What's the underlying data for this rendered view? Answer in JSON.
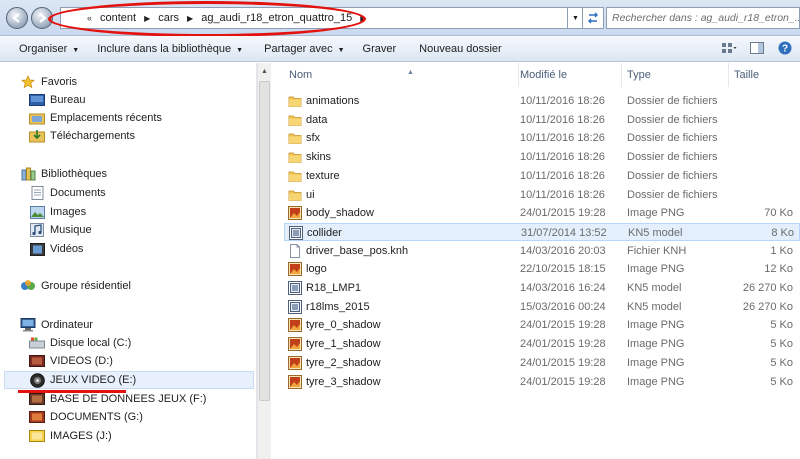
{
  "address": {
    "separator": "«",
    "crumbs": [
      "content",
      "cars",
      "ag_audi_r18_etron_quattro_15"
    ],
    "search_placeholder": "Rechercher dans : ag_audi_r18_etron_..."
  },
  "toolbar": {
    "organize": "Organiser",
    "include_library": "Inclure dans la bibliothèque",
    "share_with": "Partager avec",
    "burn": "Graver",
    "new_folder": "Nouveau dossier"
  },
  "nav": {
    "favorites": "Favoris",
    "favorites_items": [
      "Bureau",
      "Emplacements récents",
      "Téléchargements"
    ],
    "libraries": "Bibliothèques",
    "libraries_items": [
      "Documents",
      "Images",
      "Musique",
      "Vidéos"
    ],
    "homegroup": "Groupe résidentiel",
    "computer": "Ordinateur",
    "drives": [
      "Disque local (C:)",
      "VIDEOS (D:)",
      "JEUX VIDEO (E:)",
      "BASE DE DONNEES JEUX (F:)",
      "DOCUMENTS (G:)",
      "IMAGES (J:)"
    ]
  },
  "columns": {
    "name": "Nom",
    "modified": "Modifié le",
    "type": "Type",
    "size": "Taille"
  },
  "files": [
    {
      "name": "animations",
      "date": "10/11/2016 18:26",
      "type": "Dossier de fichiers",
      "size": "",
      "icon": "folder"
    },
    {
      "name": "data",
      "date": "10/11/2016 18:26",
      "type": "Dossier de fichiers",
      "size": "",
      "icon": "folder"
    },
    {
      "name": "sfx",
      "date": "10/11/2016 18:26",
      "type": "Dossier de fichiers",
      "size": "",
      "icon": "folder"
    },
    {
      "name": "skins",
      "date": "10/11/2016 18:26",
      "type": "Dossier de fichiers",
      "size": "",
      "icon": "folder"
    },
    {
      "name": "texture",
      "date": "10/11/2016 18:26",
      "type": "Dossier de fichiers",
      "size": "",
      "icon": "folder"
    },
    {
      "name": "ui",
      "date": "10/11/2016 18:26",
      "type": "Dossier de fichiers",
      "size": "",
      "icon": "folder"
    },
    {
      "name": "body_shadow",
      "date": "24/01/2015 19:28",
      "type": "Image PNG",
      "size": "70 Ko",
      "icon": "png"
    },
    {
      "name": "collider",
      "date": "31/07/2014 13:52",
      "type": "KN5 model",
      "size": "8 Ko",
      "icon": "kn5"
    },
    {
      "name": "driver_base_pos.knh",
      "date": "14/03/2016 20:03",
      "type": "Fichier KNH",
      "size": "1 Ko",
      "icon": "blank"
    },
    {
      "name": "logo",
      "date": "22/10/2015 18:15",
      "type": "Image PNG",
      "size": "12 Ko",
      "icon": "png"
    },
    {
      "name": "R18_LMP1",
      "date": "14/03/2016 16:24",
      "type": "KN5 model",
      "size": "26 270 Ko",
      "icon": "kn5"
    },
    {
      "name": "r18lms_2015",
      "date": "15/03/2016 00:24",
      "type": "KN5 model",
      "size": "26 270 Ko",
      "icon": "kn5"
    },
    {
      "name": "tyre_0_shadow",
      "date": "24/01/2015 19:28",
      "type": "Image PNG",
      "size": "5 Ko",
      "icon": "png"
    },
    {
      "name": "tyre_1_shadow",
      "date": "24/01/2015 19:28",
      "type": "Image PNG",
      "size": "5 Ko",
      "icon": "png"
    },
    {
      "name": "tyre_2_shadow",
      "date": "24/01/2015 19:28",
      "type": "Image PNG",
      "size": "5 Ko",
      "icon": "png"
    },
    {
      "name": "tyre_3_shadow",
      "date": "24/01/2015 19:28",
      "type": "Image PNG",
      "size": "5 Ko",
      "icon": "png"
    }
  ],
  "selected_file": "collider",
  "selected_drive": "JEUX VIDEO (E:)",
  "colors": {
    "annotation_red": "#e4120f",
    "selection_bg": "#e3effd",
    "folder_yellow": "#f3c552",
    "header_text": "#4c607a"
  }
}
